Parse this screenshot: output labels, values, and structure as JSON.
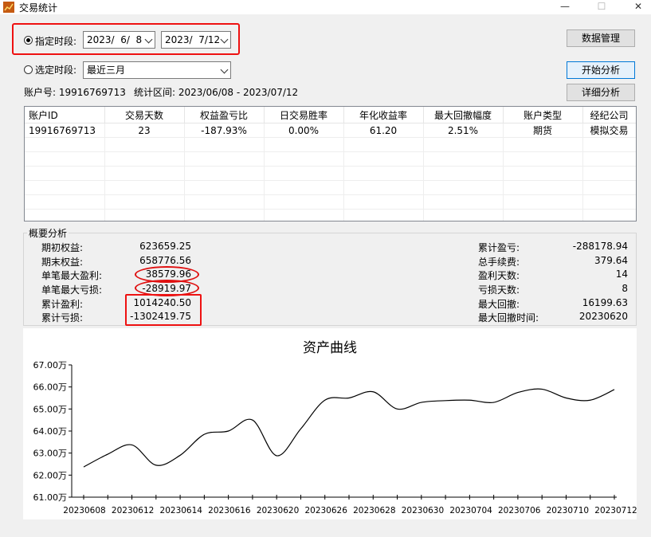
{
  "window": {
    "title": "交易统计",
    "min": "—",
    "max": "☐",
    "close": "✕"
  },
  "period": {
    "specified_label": "指定时段:",
    "start_date": "2023/  6/  8",
    "end_date": "2023/  7/12",
    "preset_label": "选定时段:",
    "preset_value": "最近三月"
  },
  "buttons": {
    "data_manage": "数据管理",
    "start_analysis": "开始分析",
    "detail_analysis": "详细分析"
  },
  "info": {
    "account_line": "账户号: 19916769713",
    "range_line": "统计区间: 2023/06/08 - 2023/07/12"
  },
  "table": {
    "headers": [
      "账户ID",
      "交易天数",
      "权益盈亏比",
      "日交易胜率",
      "年化收益率",
      "最大回撤幅度",
      "账户类型",
      "经纪公司"
    ],
    "rows": [
      [
        "19916769713",
        "23",
        "-187.93%",
        "0.00%",
        "61.20",
        "2.51%",
        "期货",
        "模拟交易"
      ]
    ]
  },
  "summary": {
    "title": "概要分析",
    "left": [
      {
        "label": "期初权益:",
        "value": "623659.25"
      },
      {
        "label": "期末权益:",
        "value": "658776.56"
      },
      {
        "label": "单笔最大盈利:",
        "value": "38579.96"
      },
      {
        "label": "单笔最大亏损:",
        "value": "-28919.97"
      },
      {
        "label": "累计盈利:",
        "value": "1014240.50"
      },
      {
        "label": "累计亏损:",
        "value": "-1302419.75"
      }
    ],
    "right": [
      {
        "label": "累计盈亏:",
        "value": "-288178.94"
      },
      {
        "label": "总手续费:",
        "value": "379.64"
      },
      {
        "label": "盈利天数:",
        "value": "14"
      },
      {
        "label": "亏损天数:",
        "value": "8"
      },
      {
        "label": "最大回撤:",
        "value": "16199.63"
      },
      {
        "label": "最大回撤时间:",
        "value": "20230620"
      }
    ]
  },
  "colors": {
    "highlight": "#ee1111",
    "line": "#000000"
  },
  "chart_data": {
    "type": "line",
    "title": "资产曲线",
    "ylim": [
      61,
      67
    ],
    "yticks": [
      "61.00万",
      "62.00万",
      "63.00万",
      "64.00万",
      "65.00万",
      "66.00万",
      "67.00万"
    ],
    "ytick_values": [
      61,
      62,
      63,
      64,
      65,
      66,
      67
    ],
    "xticks": [
      "20230608",
      "20230612",
      "20230614",
      "20230616",
      "20230620",
      "20230626",
      "20230628",
      "20230630",
      "20230704",
      "20230706",
      "20230710",
      "20230712"
    ],
    "x": [
      "20230608",
      "20230609",
      "20230612",
      "20230613",
      "20230614",
      "20230615",
      "20230616",
      "20230619",
      "20230620",
      "20230621",
      "20230626",
      "20230627",
      "20230628",
      "20230629",
      "20230630",
      "20230703",
      "20230704",
      "20230705",
      "20230706",
      "20230707",
      "20230710",
      "20230711",
      "20230712"
    ],
    "series": [
      {
        "values": [
          62.37,
          62.95,
          63.37,
          62.45,
          62.9,
          63.85,
          64.0,
          64.5,
          62.88,
          64.1,
          65.4,
          65.5,
          65.78,
          65.0,
          65.3,
          65.38,
          65.4,
          65.3,
          65.75,
          65.9,
          65.5,
          65.4,
          65.88
        ]
      }
    ]
  }
}
